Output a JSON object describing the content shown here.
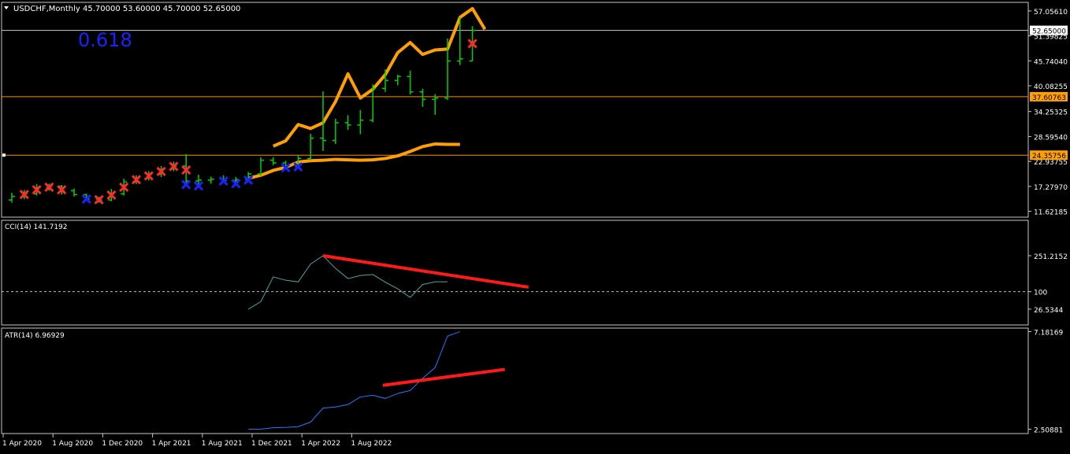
{
  "header": {
    "symbol_line": "USDCHF,Monthly  45.70000 53.60000 45.70000 52.65000",
    "fib_label": "0.618"
  },
  "colors": {
    "background": "#000000",
    "frame": "#c8c8c8",
    "bull_candle": "#00d000",
    "envelope": "#ffa000",
    "hline": "#ff8c00",
    "cci_line": "#4fa3a0",
    "atr_line": "#1e7bff",
    "trend": "#ff1a1a",
    "cross_red": "#ff2a2a",
    "cross_blue": "#1a22ff",
    "fib_text": "#1a22ff"
  },
  "chart_data": [
    {
      "type": "candlestick",
      "title": "USDCHF,Monthly",
      "ohlc_header": {
        "open": 45.7,
        "high": 53.6,
        "low": 45.7,
        "close": 52.65
      },
      "ylim": [
        10.3,
        59.0
      ],
      "y_ticks": [
        "57.05610",
        "51.39825",
        "45.74040",
        "40.08255",
        "34.25325",
        "28.59540",
        "22.93755",
        "17.27970",
        "11.62185"
      ],
      "price_tags": [
        {
          "label": "52.65000",
          "value": 52.65,
          "color": "#ffffff"
        },
        {
          "label": "37.60763",
          "value": 37.60763,
          "color": "#ffa000"
        },
        {
          "label": "24.35756",
          "value": 24.35756,
          "color": "#ffa000"
        }
      ],
      "hlines": [
        {
          "value": 52.65,
          "color": "#c8c8c8"
        },
        {
          "value": 37.60763,
          "color": "#ff8c00"
        },
        {
          "value": 24.35756,
          "color": "#ff8c00"
        }
      ],
      "candles": [
        {
          "o": 14.2,
          "h": 15.8,
          "l": 13.6,
          "c": 15.0
        },
        {
          "o": 15.0,
          "h": 16.5,
          "l": 14.4,
          "c": 15.6
        },
        {
          "o": 15.6,
          "h": 17.8,
          "l": 15.2,
          "c": 17.0
        },
        {
          "o": 17.0,
          "h": 17.9,
          "l": 16.3,
          "c": 17.3
        },
        {
          "o": 17.3,
          "h": 17.6,
          "l": 15.4,
          "c": 16.3
        },
        {
          "o": 16.3,
          "h": 16.8,
          "l": 15.0,
          "c": 15.4
        },
        {
          "o": 15.4,
          "h": 15.6,
          "l": 14.1,
          "c": 14.4
        },
        {
          "o": 14.4,
          "h": 14.9,
          "l": 13.6,
          "c": 14.2
        },
        {
          "o": 14.2,
          "h": 16.7,
          "l": 13.9,
          "c": 15.6
        },
        {
          "o": 15.6,
          "h": 19.0,
          "l": 15.2,
          "c": 18.3
        },
        {
          "o": 18.3,
          "h": 19.8,
          "l": 17.8,
          "c": 19.1
        },
        {
          "o": 19.1,
          "h": 20.7,
          "l": 18.6,
          "c": 20.0
        },
        {
          "o": 20.0,
          "h": 21.9,
          "l": 19.4,
          "c": 21.2
        },
        {
          "o": 21.2,
          "h": 22.9,
          "l": 20.7,
          "c": 21.9
        },
        {
          "o": 21.9,
          "h": 24.6,
          "l": 17.4,
          "c": 18.5
        },
        {
          "o": 18.5,
          "h": 19.9,
          "l": 17.1,
          "c": 18.7
        },
        {
          "o": 18.7,
          "h": 19.5,
          "l": 17.9,
          "c": 18.9
        },
        {
          "o": 18.9,
          "h": 19.8,
          "l": 18.2,
          "c": 18.6
        },
        {
          "o": 18.6,
          "h": 19.4,
          "l": 17.6,
          "c": 18.8
        },
        {
          "o": 18.8,
          "h": 20.5,
          "l": 18.4,
          "c": 20.1
        },
        {
          "o": 20.1,
          "h": 23.9,
          "l": 19.7,
          "c": 23.2
        },
        {
          "o": 23.2,
          "h": 23.9,
          "l": 22.1,
          "c": 22.6
        },
        {
          "o": 22.6,
          "h": 23.1,
          "l": 21.2,
          "c": 21.8
        },
        {
          "o": 21.8,
          "h": 24.3,
          "l": 21.4,
          "c": 23.6
        },
        {
          "o": 23.6,
          "h": 29.2,
          "l": 23.2,
          "c": 28.2
        },
        {
          "o": 28.2,
          "h": 38.8,
          "l": 25.3,
          "c": 27.7
        },
        {
          "o": 27.7,
          "h": 32.6,
          "l": 26.9,
          "c": 31.7
        },
        {
          "o": 31.7,
          "h": 33.4,
          "l": 30.1,
          "c": 31.2
        },
        {
          "o": 31.2,
          "h": 34.6,
          "l": 29.1,
          "c": 32.3
        },
        {
          "o": 32.3,
          "h": 40.4,
          "l": 31.8,
          "c": 39.5
        },
        {
          "o": 39.5,
          "h": 43.8,
          "l": 38.7,
          "c": 41.3
        },
        {
          "o": 41.3,
          "h": 42.6,
          "l": 40.2,
          "c": 42.2
        },
        {
          "o": 42.2,
          "h": 43.5,
          "l": 38.1,
          "c": 38.7
        },
        {
          "o": 38.7,
          "h": 39.4,
          "l": 35.3,
          "c": 37.0
        },
        {
          "o": 37.0,
          "h": 38.2,
          "l": 33.5,
          "c": 37.3
        },
        {
          "o": 37.3,
          "h": 50.8,
          "l": 36.9,
          "c": 45.7
        },
        {
          "o": 45.7,
          "h": 55.6,
          "l": 44.8,
          "c": 46.2
        },
        {
          "o": 45.7,
          "h": 53.6,
          "l": 45.7,
          "c": 52.65
        }
      ],
      "envelope_upper": [
        null,
        null,
        null,
        null,
        null,
        null,
        null,
        null,
        null,
        null,
        null,
        null,
        null,
        null,
        null,
        null,
        null,
        null,
        null,
        null,
        null,
        26.4,
        27.6,
        31.3,
        30.4,
        31.7,
        36.5,
        42.8,
        37.3,
        39.3,
        42.6,
        47.6,
        49.9,
        47.2,
        48.2,
        48.4,
        55.6,
        57.6,
        52.9
      ],
      "envelope_lower": [
        null,
        null,
        null,
        null,
        null,
        null,
        null,
        null,
        null,
        null,
        null,
        null,
        null,
        null,
        null,
        null,
        null,
        null,
        null,
        19.1,
        19.8,
        20.9,
        21.6,
        22.8,
        23.1,
        23.2,
        23.4,
        23.3,
        23.2,
        23.3,
        23.6,
        24.2,
        25.2,
        26.3,
        26.9,
        26.8,
        26.8
      ],
      "sell_signals": [
        1,
        2,
        3,
        4,
        7,
        8,
        9,
        10,
        11,
        12,
        13,
        14,
        37
      ],
      "buy_signals": [
        6,
        14,
        15,
        17,
        18,
        19,
        22,
        23
      ]
    },
    {
      "type": "line",
      "title": "CCI(14) 141.7192",
      "name": "CCI(14)",
      "ylim": [
        -40,
        400
      ],
      "y_ticks": [
        "251.2152",
        "100",
        "26.5344"
      ],
      "reference_level": 100,
      "x_index": [
        19,
        20,
        21,
        22,
        23,
        24,
        25,
        26,
        27,
        28,
        29,
        30,
        31,
        32,
        33,
        34,
        35,
        36,
        37
      ],
      "values": [
        26.5,
        58.0,
        162.0,
        148.0,
        141.0,
        216.0,
        251.2,
        198.0,
        155.0,
        168.0,
        172.0,
        140.0,
        112.0,
        76.0,
        130.0,
        141.7,
        141.7,
        null,
        null
      ],
      "trendline": {
        "from": {
          "x": 25,
          "y": 251.2
        },
        "to": {
          "x": 41.5,
          "y": 119.0
        }
      }
    },
    {
      "type": "line",
      "title": "ATR(14) 6.96929",
      "name": "ATR(14)",
      "ylim": [
        2.3,
        7.35
      ],
      "y_ticks": [
        "7.18169",
        "2.50881"
      ],
      "x_index": [
        19,
        20,
        21,
        22,
        23,
        24,
        25,
        26,
        27,
        28,
        29,
        30,
        31,
        32,
        33,
        34,
        35,
        36
      ],
      "values": [
        2.50881,
        2.51,
        2.58,
        2.59,
        2.63,
        2.85,
        3.52,
        3.57,
        3.69,
        4.05,
        4.13,
        3.98,
        4.22,
        4.36,
        4.95,
        5.46,
        6.96929,
        7.18169
      ],
      "trendline": {
        "from": {
          "x": 29.8,
          "y": 4.61
        },
        "to": {
          "x": 39.6,
          "y": 5.37
        }
      }
    }
  ],
  "x_axis": {
    "ticks": [
      {
        "label": "1 Apr 2020",
        "index": 0
      },
      {
        "label": "1 Aug 2020",
        "index": 4
      },
      {
        "label": "1 Dec 2020",
        "index": 8
      },
      {
        "label": "1 Apr 2021",
        "index": 12
      },
      {
        "label": "1 Aug 2021",
        "index": 16
      },
      {
        "label": "1 Dec 2021",
        "index": 20
      },
      {
        "label": "1 Apr 2022",
        "index": 24
      },
      {
        "label": "1 Aug 2022",
        "index": 28
      }
    ]
  }
}
